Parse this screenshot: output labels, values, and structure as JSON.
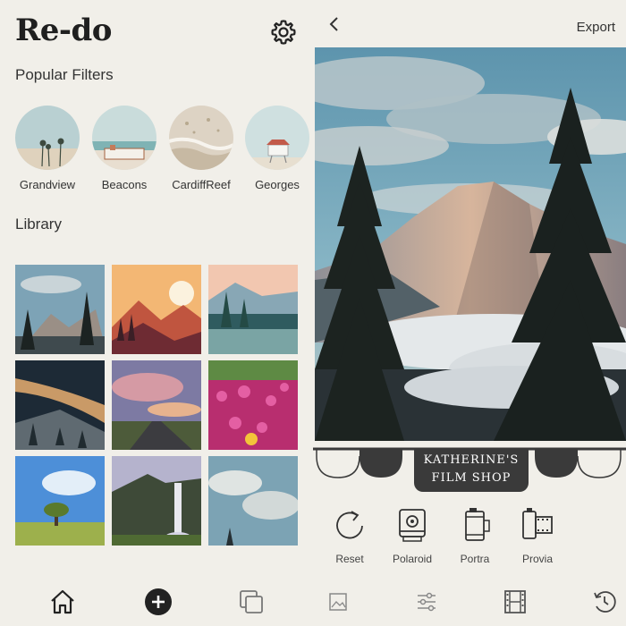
{
  "app": {
    "logo": "Re-do"
  },
  "popular_filters": {
    "title": "Popular Filters",
    "items": [
      {
        "label": "Grandview"
      },
      {
        "label": "Beacons"
      },
      {
        "label": "CardiffReef"
      },
      {
        "label": "Georges"
      }
    ]
  },
  "library": {
    "title": "Library"
  },
  "editor": {
    "export_label": "Export",
    "banner_line1": "KATHERINE'S",
    "banner_line2": "FILM SHOP",
    "tools": [
      {
        "label": "Reset"
      },
      {
        "label": "Polaroid"
      },
      {
        "label": "Portra"
      },
      {
        "label": "Provia"
      }
    ]
  },
  "colors": {
    "background": "#f1efe9",
    "dark": "#333333",
    "awning": "#3a3a3a"
  }
}
